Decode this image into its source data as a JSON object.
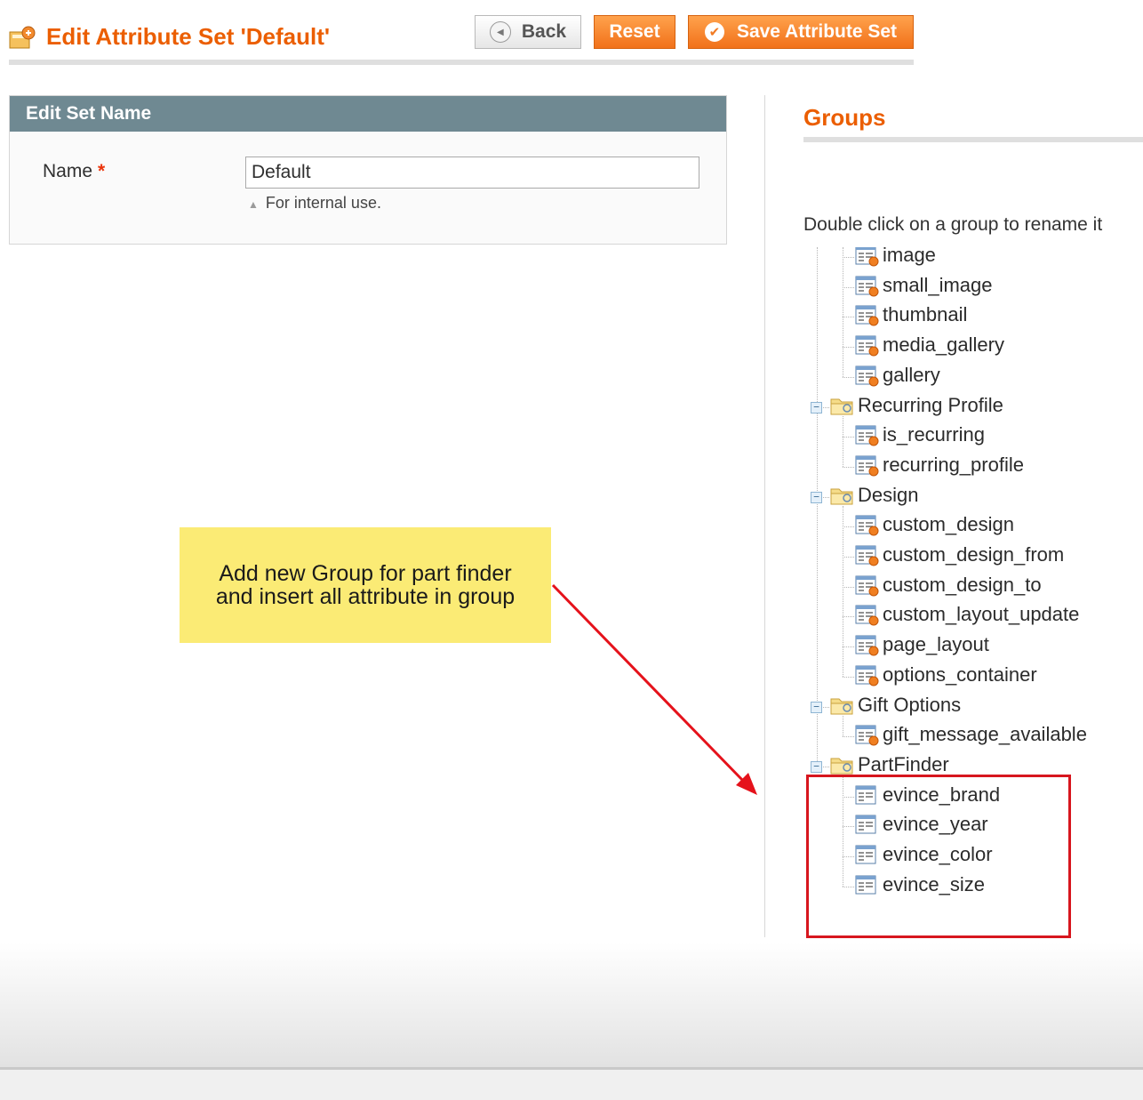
{
  "header": {
    "title": "Edit Attribute Set 'Default'",
    "buttons": {
      "back": "Back",
      "reset": "Reset",
      "save": "Save Attribute Set"
    }
  },
  "edit_set_name": {
    "panel_title": "Edit Set Name",
    "name_label": "Name",
    "required_mark": "*",
    "name_value": "Default",
    "hint": "For internal use."
  },
  "groups": {
    "title": "Groups",
    "hint": "Double click on a group to rename it",
    "tree": [
      {
        "type": "attribute",
        "label": "image"
      },
      {
        "type": "attribute",
        "label": "small_image"
      },
      {
        "type": "attribute",
        "label": "thumbnail"
      },
      {
        "type": "attribute",
        "label": "media_gallery"
      },
      {
        "type": "attribute",
        "label": "gallery"
      },
      {
        "type": "group",
        "label": "Recurring Profile"
      },
      {
        "type": "attribute",
        "label": "is_recurring"
      },
      {
        "type": "attribute",
        "label": "recurring_profile"
      },
      {
        "type": "group",
        "label": "Design"
      },
      {
        "type": "attribute",
        "label": "custom_design"
      },
      {
        "type": "attribute",
        "label": "custom_design_from"
      },
      {
        "type": "attribute",
        "label": "custom_design_to"
      },
      {
        "type": "attribute",
        "label": "custom_layout_update"
      },
      {
        "type": "attribute",
        "label": "page_layout"
      },
      {
        "type": "attribute",
        "label": "options_container"
      },
      {
        "type": "group",
        "label": "Gift Options"
      },
      {
        "type": "attribute",
        "label": "gift_message_available"
      },
      {
        "type": "group",
        "label": "PartFinder"
      },
      {
        "type": "user-attribute",
        "label": "evince_brand"
      },
      {
        "type": "user-attribute",
        "label": "evince_year"
      },
      {
        "type": "user-attribute",
        "label": "evince_color"
      },
      {
        "type": "user-attribute",
        "label": "evince_size"
      }
    ]
  },
  "callout": {
    "line1": "Add new Group for part finder",
    "line2": "and insert all attribute in group"
  },
  "colors": {
    "accent": "#eb5e00",
    "panel_header": "#6f8992",
    "callout_bg": "#fbeb75",
    "highlight": "#d7161e"
  }
}
